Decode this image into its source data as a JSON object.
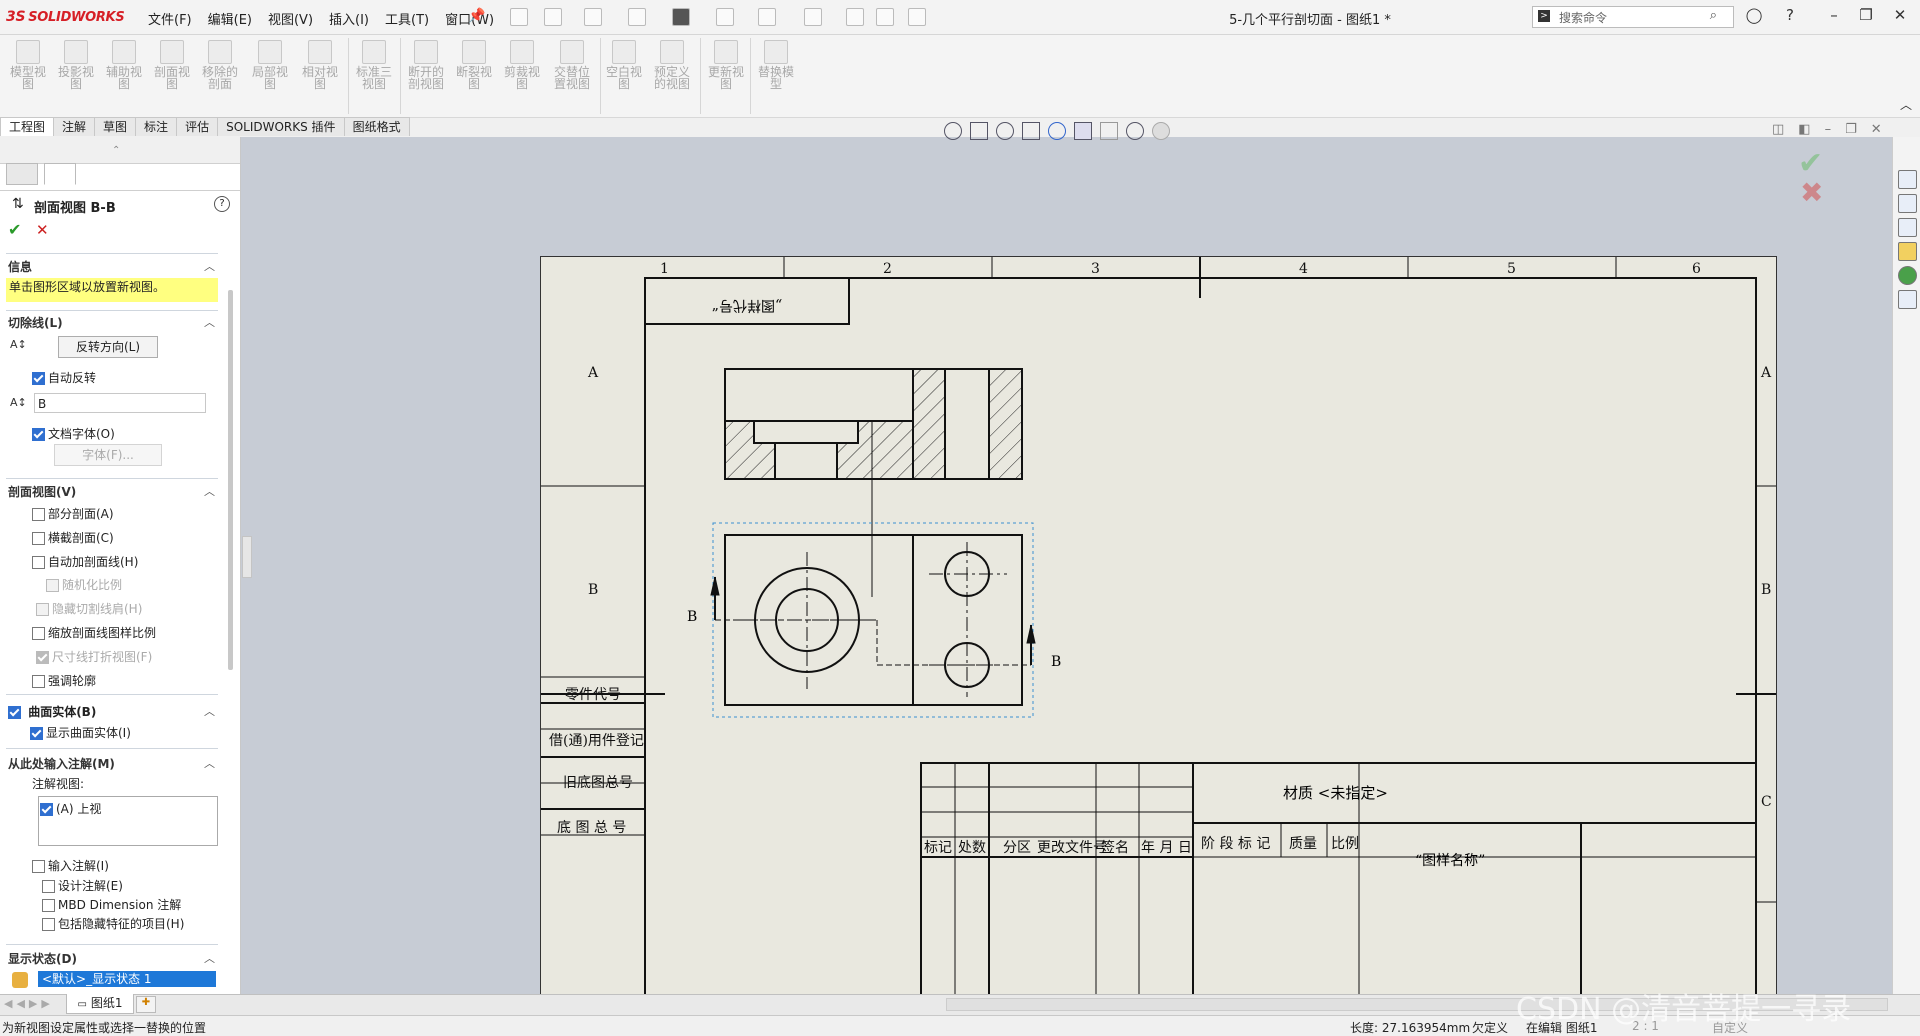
{
  "app": {
    "logo": "SOLIDWORKS",
    "logo_mark": "3S"
  },
  "menu": [
    "文件(F)",
    "编辑(E)",
    "视图(V)",
    "插入(I)",
    "工具(T)",
    "窗口(W)"
  ],
  "document_title": "5-几个平行剖切面 - 图纸1 *",
  "search": {
    "placeholder": "搜索命令"
  },
  "ribbon": {
    "buttons": [
      "模型视图",
      "投影视图",
      "辅助视图",
      "剖面视图",
      "移除的剖面",
      "局部视图",
      "相对视图",
      "标准三视图",
      "断开的剖视图",
      "断裂视图",
      "剪裁视图",
      "交替位置视图",
      "空白视图",
      "预定义的视图",
      "更新视图",
      "替换模型"
    ]
  },
  "tabs": [
    "工程图",
    "注解",
    "草图",
    "标注",
    "评估",
    "SOLIDWORKS 插件",
    "图纸格式"
  ],
  "panel": {
    "title": "剖面视图 B-B",
    "info": {
      "header": "信息",
      "message": "单击图形区域以放置新视图。"
    },
    "cutline": {
      "header": "切除线(L)",
      "flip_button": "反转方向(L)",
      "auto_flip": "自动反转",
      "label_value": "B",
      "doc_font": "文档字体(O)",
      "font_button": "字体(F)..."
    },
    "section_view": {
      "header": "剖面视图(V)",
      "options": [
        {
          "label": "部分剖面(A)",
          "checked": false,
          "disabled": false,
          "indent": 0
        },
        {
          "label": "横截剖面(C)",
          "checked": false,
          "disabled": false,
          "indent": 0
        },
        {
          "label": "自动加剖面线(H)",
          "checked": false,
          "disabled": false,
          "indent": 0
        },
        {
          "label": "随机化比例",
          "checked": false,
          "disabled": true,
          "indent": 1
        },
        {
          "label": "隐藏切割线肩(H)",
          "checked": false,
          "disabled": true,
          "indent": 0
        },
        {
          "label": "缩放剖面线图样比例",
          "checked": false,
          "disabled": false,
          "indent": 0
        },
        {
          "label": "尺寸线打折视图(F)",
          "checked": true,
          "disabled": true,
          "indent": 0
        },
        {
          "label": "强调轮廓",
          "checked": false,
          "disabled": false,
          "indent": 0
        }
      ]
    },
    "surface_bodies": {
      "header": "曲面实体(B)",
      "show": "显示曲面实体(I)"
    },
    "import_annotations": {
      "header": "从此处输入注解(M)",
      "annotation_view_label": "注解视图:",
      "list_item": "(A) 上视",
      "input_annotations": "输入注解(I)",
      "design_annotations": "设计注解(E)",
      "mbd": "MBD Dimension 注解",
      "hidden_features": "包括隐藏特征的项目(H)"
    },
    "display_state": {
      "header": "显示状态(D)",
      "value": "<默认>_显示状态 1"
    }
  },
  "drawing": {
    "zone_cols": [
      "1",
      "2",
      "3",
      "4",
      "5",
      "6"
    ],
    "zone_rows": [
      "A",
      "B",
      "C"
    ],
    "top_label": "„图样代号“",
    "section_labels": [
      "B",
      "B"
    ],
    "left_table": [
      "零件代号",
      "借(通)用件登记",
      "旧底图总号",
      "底 图 总 号"
    ],
    "title_block": {
      "material": "材质 <未指定>",
      "headers": [
        "标记",
        "处数",
        "分区",
        "更改文件号",
        "签名",
        "年 月 日"
      ],
      "stage_headers": [
        "阶 段 标 记",
        "质量",
        "比例"
      ],
      "drawing_name": "“图样名称”"
    }
  },
  "sheet_tab": "图纸1",
  "status": {
    "left": "为新视图设定属性或选择一替换的位置",
    "length": "长度: 27.163954mm",
    "defined": "欠定义",
    "editing": "在编辑 图纸1",
    "scale": "2 : 1",
    "custom": "自定义"
  },
  "watermark": "CSDN @清音菩提一寻录"
}
